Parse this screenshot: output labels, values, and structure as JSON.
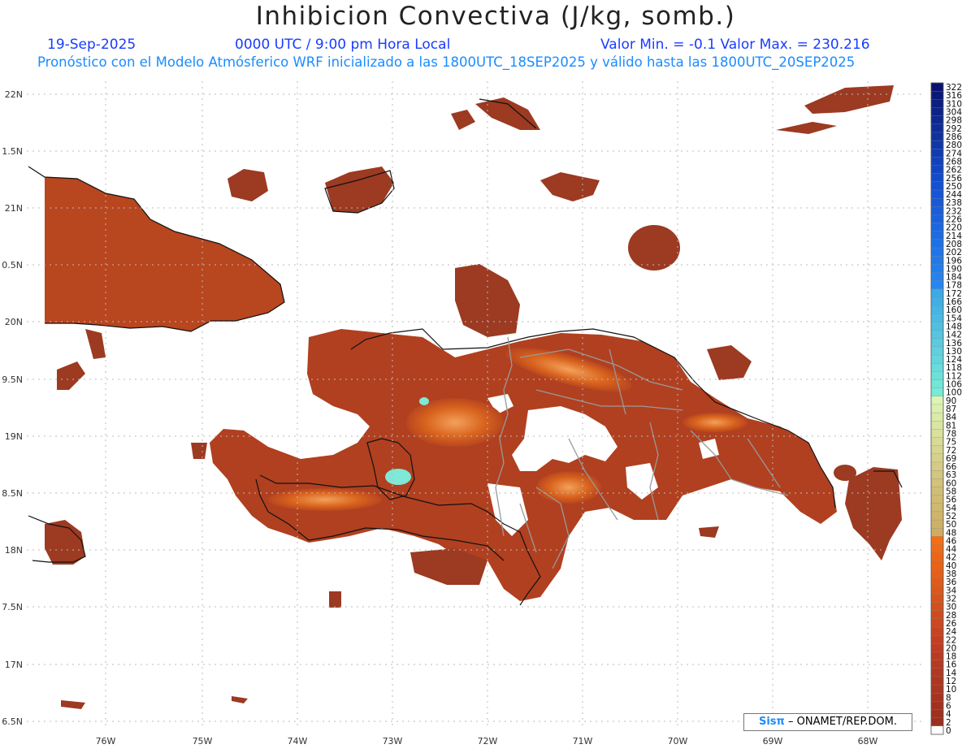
{
  "title": "Inhibicion Convectiva (J/kg, somb.)",
  "date": "19-Sep-2025",
  "time": "0000 UTC / 9:00 pm Hora Local",
  "minmax": "Valor Min. = -0.1  Valor Max. = 230.216",
  "subtitle": "Pronóstico con el Modelo Atmósferico WRF inicializado a las 1800UTC_18SEP2025 y válido hasta las  1800UTC_20SEP2025",
  "lat_labels": [
    "22N",
    "1.5N",
    "21N",
    "0.5N",
    "20N",
    "9.5N",
    "19N",
    "8.5N",
    "18N",
    "7.5N",
    "17N",
    "6.5N"
  ],
  "lon_labels": [
    "76W",
    "75W",
    "74W",
    "73W",
    "72W",
    "71W",
    "70W",
    "69W",
    "68W"
  ],
  "colorbar_labels": [
    "322",
    "316",
    "310",
    "304",
    "298",
    "292",
    "286",
    "280",
    "274",
    "268",
    "262",
    "256",
    "250",
    "244",
    "238",
    "232",
    "226",
    "220",
    "214",
    "208",
    "202",
    "196",
    "190",
    "184",
    "178",
    "172",
    "166",
    "160",
    "154",
    "148",
    "142",
    "136",
    "130",
    "124",
    "118",
    "112",
    "106",
    "100",
    "90",
    "87",
    "84",
    "81",
    "78",
    "75",
    "72",
    "69",
    "66",
    "63",
    "60",
    "58",
    "56",
    "54",
    "52",
    "50",
    "48",
    "46",
    "44",
    "42",
    "40",
    "38",
    "36",
    "34",
    "32",
    "30",
    "28",
    "26",
    "24",
    "22",
    "20",
    "18",
    "16",
    "14",
    "12",
    "10",
    "8",
    "6",
    "4",
    "2",
    "0"
  ],
  "credit": {
    "prefix": "Sis",
    "pi": "π",
    "suffix": "– ONAMET/REP.DOM."
  },
  "colors": {
    "field_dark": "#9c3a22",
    "field_mid": "#b8461f",
    "field_hot": "#d9641e",
    "high_cape": "#7fe8d6",
    "coast": "#111111",
    "border": "#999999",
    "header_blue": "#1a3cff",
    "subtitle_blue": "#1a8cff"
  },
  "units": "J/kg"
}
